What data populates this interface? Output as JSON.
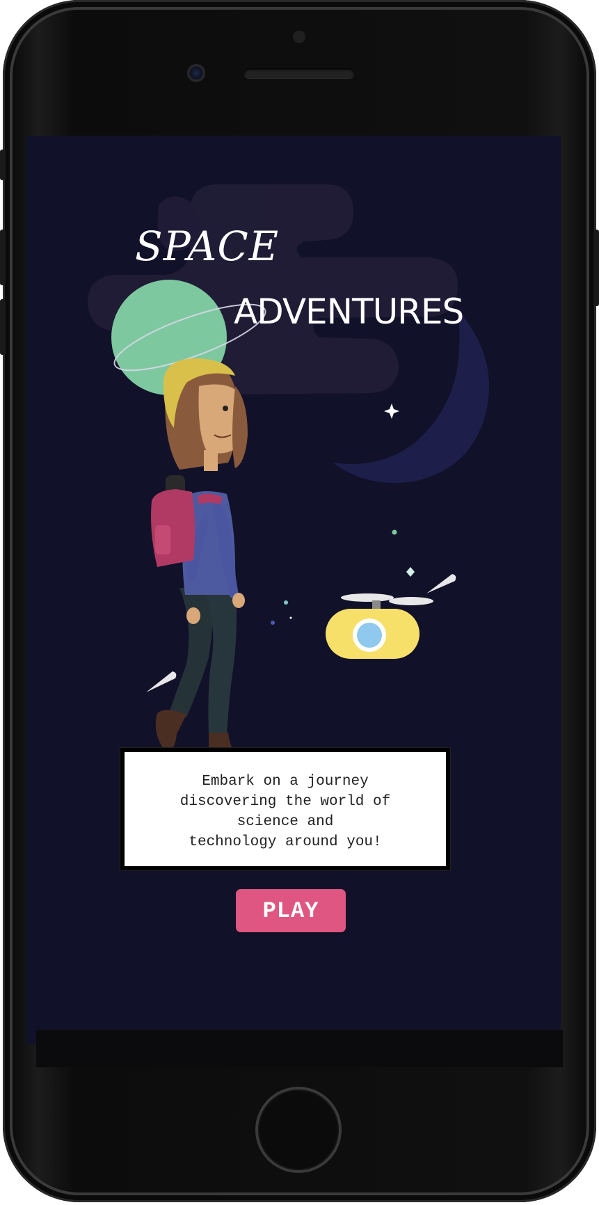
{
  "app": {
    "title_line1": "SPACE",
    "title_line2": "ADVENTURES"
  },
  "intro": {
    "text": "Embark on a journey\ndiscovering the world of\nscience and\ntechnology around you!"
  },
  "actions": {
    "play_label": "PLAY"
  },
  "colors": {
    "background": "#12112a",
    "accent": "#de5681",
    "planet": "#7ec8a0",
    "robot": "#f7e06a"
  },
  "icons": {
    "illustration": "girl-with-backpack",
    "planet": "ringed-planet-icon",
    "moon": "crescent-moon-icon",
    "robot": "flying-robot-icon",
    "stars": "sparkle-star-icon"
  }
}
